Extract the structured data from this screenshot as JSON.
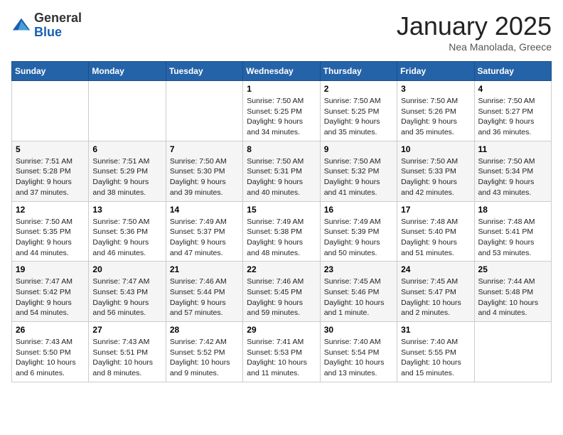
{
  "header": {
    "logo_general": "General",
    "logo_blue": "Blue",
    "month_title": "January 2025",
    "location": "Nea Manolada, Greece"
  },
  "days_of_week": [
    "Sunday",
    "Monday",
    "Tuesday",
    "Wednesday",
    "Thursday",
    "Friday",
    "Saturday"
  ],
  "weeks": [
    [
      {
        "day": "",
        "info": ""
      },
      {
        "day": "",
        "info": ""
      },
      {
        "day": "",
        "info": ""
      },
      {
        "day": "1",
        "info": "Sunrise: 7:50 AM\nSunset: 5:25 PM\nDaylight: 9 hours\nand 34 minutes."
      },
      {
        "day": "2",
        "info": "Sunrise: 7:50 AM\nSunset: 5:25 PM\nDaylight: 9 hours\nand 35 minutes."
      },
      {
        "day": "3",
        "info": "Sunrise: 7:50 AM\nSunset: 5:26 PM\nDaylight: 9 hours\nand 35 minutes."
      },
      {
        "day": "4",
        "info": "Sunrise: 7:50 AM\nSunset: 5:27 PM\nDaylight: 9 hours\nand 36 minutes."
      }
    ],
    [
      {
        "day": "5",
        "info": "Sunrise: 7:51 AM\nSunset: 5:28 PM\nDaylight: 9 hours\nand 37 minutes."
      },
      {
        "day": "6",
        "info": "Sunrise: 7:51 AM\nSunset: 5:29 PM\nDaylight: 9 hours\nand 38 minutes."
      },
      {
        "day": "7",
        "info": "Sunrise: 7:50 AM\nSunset: 5:30 PM\nDaylight: 9 hours\nand 39 minutes."
      },
      {
        "day": "8",
        "info": "Sunrise: 7:50 AM\nSunset: 5:31 PM\nDaylight: 9 hours\nand 40 minutes."
      },
      {
        "day": "9",
        "info": "Sunrise: 7:50 AM\nSunset: 5:32 PM\nDaylight: 9 hours\nand 41 minutes."
      },
      {
        "day": "10",
        "info": "Sunrise: 7:50 AM\nSunset: 5:33 PM\nDaylight: 9 hours\nand 42 minutes."
      },
      {
        "day": "11",
        "info": "Sunrise: 7:50 AM\nSunset: 5:34 PM\nDaylight: 9 hours\nand 43 minutes."
      }
    ],
    [
      {
        "day": "12",
        "info": "Sunrise: 7:50 AM\nSunset: 5:35 PM\nDaylight: 9 hours\nand 44 minutes."
      },
      {
        "day": "13",
        "info": "Sunrise: 7:50 AM\nSunset: 5:36 PM\nDaylight: 9 hours\nand 46 minutes."
      },
      {
        "day": "14",
        "info": "Sunrise: 7:49 AM\nSunset: 5:37 PM\nDaylight: 9 hours\nand 47 minutes."
      },
      {
        "day": "15",
        "info": "Sunrise: 7:49 AM\nSunset: 5:38 PM\nDaylight: 9 hours\nand 48 minutes."
      },
      {
        "day": "16",
        "info": "Sunrise: 7:49 AM\nSunset: 5:39 PM\nDaylight: 9 hours\nand 50 minutes."
      },
      {
        "day": "17",
        "info": "Sunrise: 7:48 AM\nSunset: 5:40 PM\nDaylight: 9 hours\nand 51 minutes."
      },
      {
        "day": "18",
        "info": "Sunrise: 7:48 AM\nSunset: 5:41 PM\nDaylight: 9 hours\nand 53 minutes."
      }
    ],
    [
      {
        "day": "19",
        "info": "Sunrise: 7:47 AM\nSunset: 5:42 PM\nDaylight: 9 hours\nand 54 minutes."
      },
      {
        "day": "20",
        "info": "Sunrise: 7:47 AM\nSunset: 5:43 PM\nDaylight: 9 hours\nand 56 minutes."
      },
      {
        "day": "21",
        "info": "Sunrise: 7:46 AM\nSunset: 5:44 PM\nDaylight: 9 hours\nand 57 minutes."
      },
      {
        "day": "22",
        "info": "Sunrise: 7:46 AM\nSunset: 5:45 PM\nDaylight: 9 hours\nand 59 minutes."
      },
      {
        "day": "23",
        "info": "Sunrise: 7:45 AM\nSunset: 5:46 PM\nDaylight: 10 hours\nand 1 minute."
      },
      {
        "day": "24",
        "info": "Sunrise: 7:45 AM\nSunset: 5:47 PM\nDaylight: 10 hours\nand 2 minutes."
      },
      {
        "day": "25",
        "info": "Sunrise: 7:44 AM\nSunset: 5:48 PM\nDaylight: 10 hours\nand 4 minutes."
      }
    ],
    [
      {
        "day": "26",
        "info": "Sunrise: 7:43 AM\nSunset: 5:50 PM\nDaylight: 10 hours\nand 6 minutes."
      },
      {
        "day": "27",
        "info": "Sunrise: 7:43 AM\nSunset: 5:51 PM\nDaylight: 10 hours\nand 8 minutes."
      },
      {
        "day": "28",
        "info": "Sunrise: 7:42 AM\nSunset: 5:52 PM\nDaylight: 10 hours\nand 9 minutes."
      },
      {
        "day": "29",
        "info": "Sunrise: 7:41 AM\nSunset: 5:53 PM\nDaylight: 10 hours\nand 11 minutes."
      },
      {
        "day": "30",
        "info": "Sunrise: 7:40 AM\nSunset: 5:54 PM\nDaylight: 10 hours\nand 13 minutes."
      },
      {
        "day": "31",
        "info": "Sunrise: 7:40 AM\nSunset: 5:55 PM\nDaylight: 10 hours\nand 15 minutes."
      },
      {
        "day": "",
        "info": ""
      }
    ]
  ]
}
